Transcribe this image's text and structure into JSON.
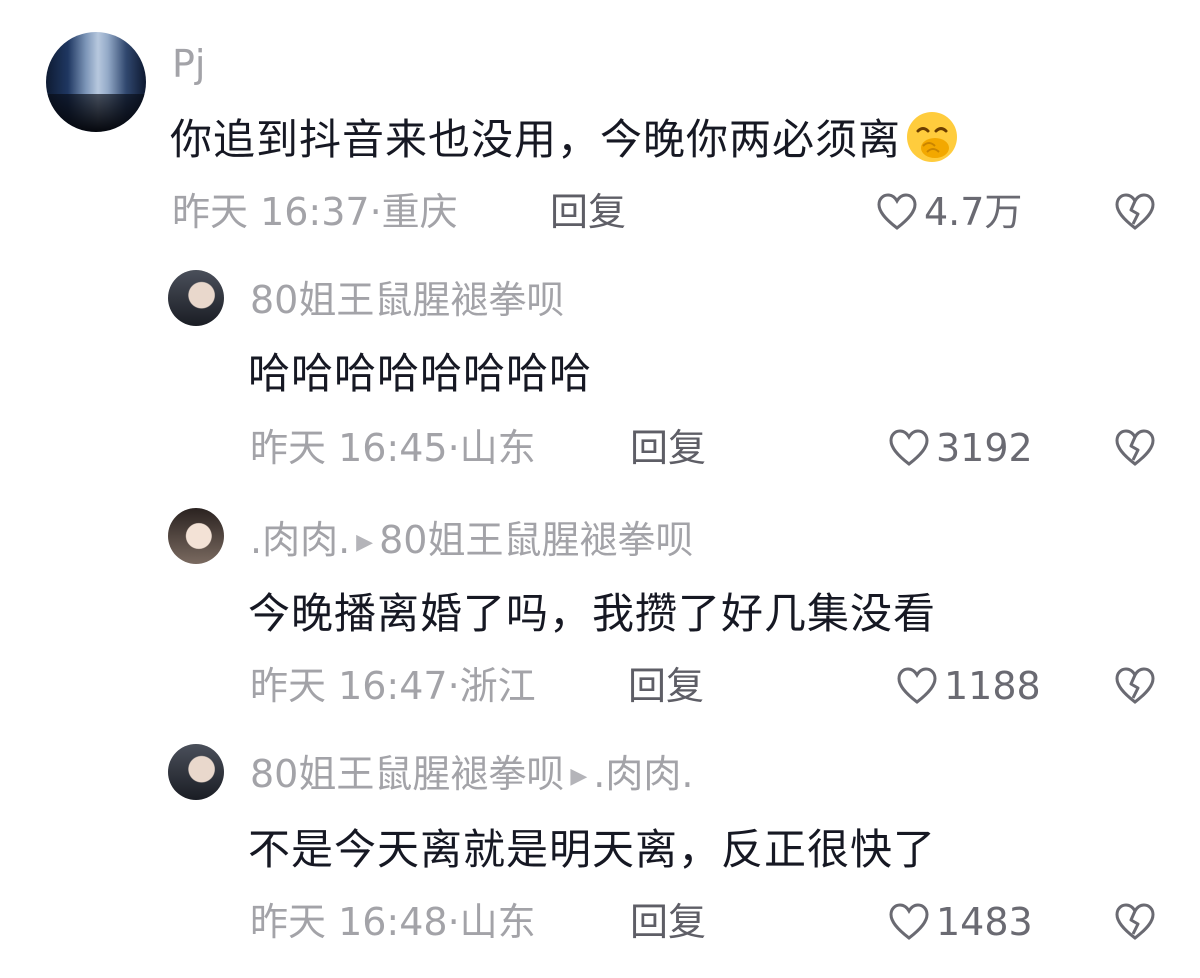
{
  "comments": [
    {
      "username": "Pj",
      "text": "你追到抖音来也没用，今晚你两必须离",
      "emoji": "hand-over-mouth-emoji",
      "meta": "昨天 16:37·重庆",
      "reply_label": "回复",
      "likes": "4.7万"
    },
    {
      "username": "80姐王鼠腥褪拳呗",
      "text": "哈哈哈哈哈哈哈哈",
      "meta": "昨天 16:45·山东",
      "reply_label": "回复",
      "likes": "3192"
    },
    {
      "username": ".肉肉.",
      "reply_to": "80姐王鼠腥褪拳呗",
      "text": "今晚播离婚了吗，我攒了好几集没看",
      "meta": "昨天 16:47·浙江",
      "reply_label": "回复",
      "likes": "1188"
    },
    {
      "username": "80姐王鼠腥褪拳呗",
      "reply_to": ".肉肉.",
      "text": "不是今天离就是明天离，反正很快了",
      "meta": "昨天 16:48·山东",
      "reply_label": "回复",
      "likes": "1483"
    }
  ],
  "icons": {
    "like": "heart-outline-icon",
    "dislike": "broken-heart-icon",
    "reply_arrow": "right-triangle-icon"
  },
  "colors": {
    "text": "#161823",
    "secondary": "#a3a3a8",
    "reply": "#5e5e66"
  }
}
